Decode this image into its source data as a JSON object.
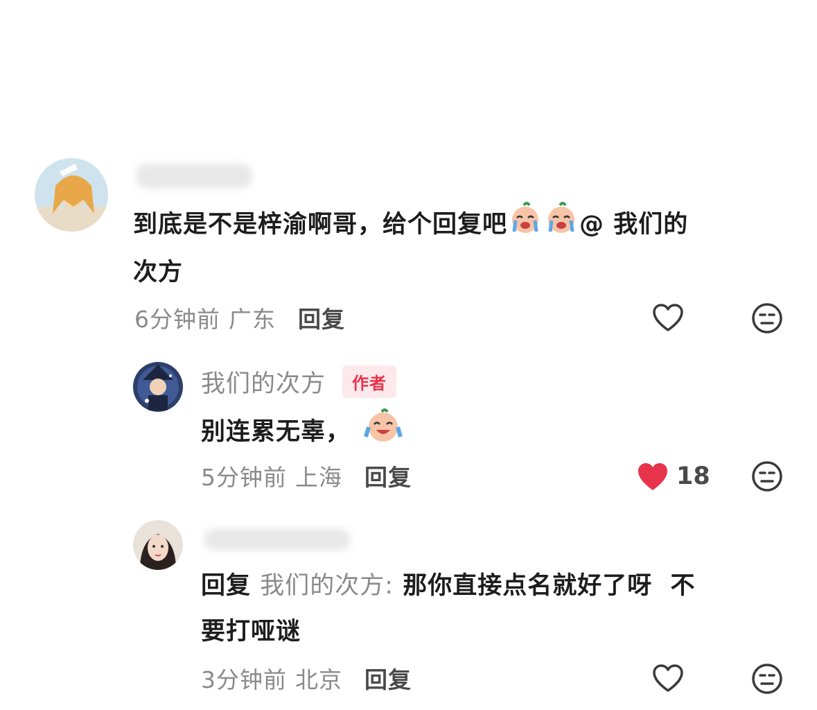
{
  "comments": [
    {
      "text_main": "到底是不是梓渝啊哥，给个回复吧",
      "mention": "@ 我们的",
      "text_line2": "次方",
      "time": "6分钟前",
      "location": "广东",
      "reply_label": "回复",
      "liked": false
    },
    {
      "username": "我们的次方",
      "author_tag": "作者",
      "text": "别连累无辜，",
      "time": "5分钟前",
      "location": "上海",
      "reply_label": "回复",
      "liked": true,
      "like_count": "18"
    },
    {
      "reply_prefix": "回复",
      "reply_to": "我们的次方:",
      "text_main": "那你直接点名就好了呀  不",
      "text_line2": "要打哑谜",
      "time": "3分钟前",
      "location": "北京",
      "reply_label": "回复",
      "liked": false
    }
  ],
  "colors": {
    "accent_red": "#e8344b",
    "meta_gray": "#8a8a8a"
  },
  "icons": [
    "heart-outline-icon",
    "heart-filled-icon",
    "dislike-face-icon",
    "crying-emoji"
  ]
}
